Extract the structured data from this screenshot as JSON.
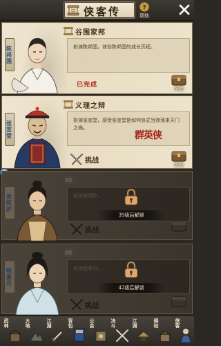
{
  "header": {
    "title": "侠客传",
    "help_label": "帮助"
  },
  "cards": [
    {
      "name": "陈邦国",
      "chapter_title": "谷围家邦",
      "description": "扮演陈邦国，体验陈邦国的成长历程。",
      "stamp": "已完成",
      "reward_label": "奖励"
    },
    {
      "name": "张宣堂",
      "chapter_title": "义理之辩",
      "description": "扮演张宣堂，感受张宣堂是如何协式当浪荡来天门之祸。",
      "calligraphy": "群英侠",
      "challenge_label": "挑战",
      "reward_label": "奖励"
    },
    {
      "name": "宫阿护",
      "chapter_title": "",
      "description": "扮演宫阿护，",
      "unlock_text": "39级后解锁",
      "challenge_label": "挑战"
    },
    {
      "name": "程素月",
      "chapter_title": "",
      "description": "扮演程素月，",
      "unlock_text": "42级后解锁",
      "challenge_label": "挑战"
    }
  ],
  "bottom_nav": [
    {
      "label": "武林"
    },
    {
      "label": "大地"
    },
    {
      "label": "江湖"
    },
    {
      "label": "背包"
    },
    {
      "label": "公会"
    },
    {
      "label": "决斗"
    },
    {
      "label": "江湖"
    },
    {
      "label": "驿站"
    },
    {
      "label": "侠客"
    }
  ],
  "colors": {
    "stamp_red": "#b0291c",
    "name_blue": "#2e4f7a",
    "parchment": "#efe5cf"
  },
  "icons": [
    "scroll-icon",
    "help-icon",
    "close-icon",
    "lock-icon",
    "crossed-swords-icon",
    "reward-chest-icon"
  ]
}
